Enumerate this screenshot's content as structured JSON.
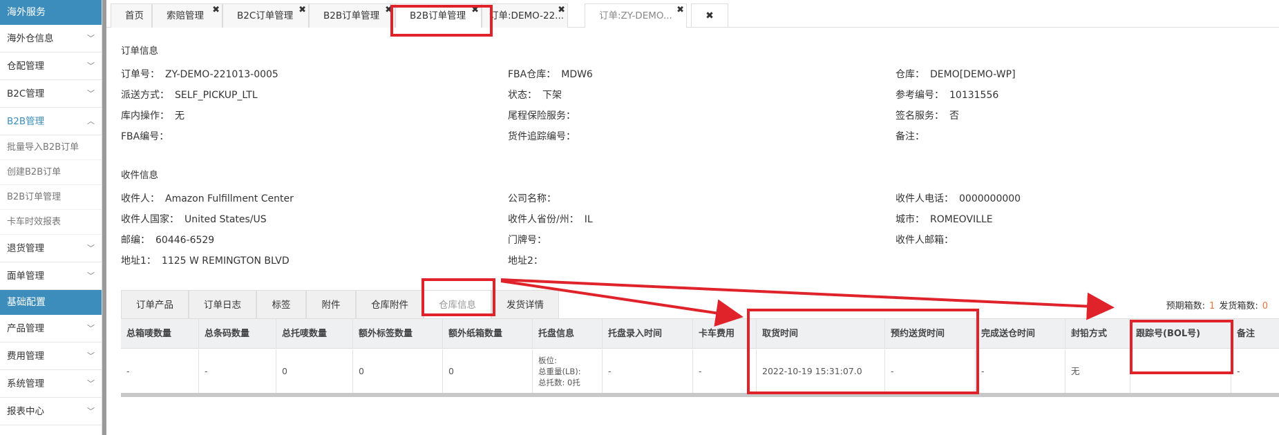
{
  "sidebar": {
    "header1": "海外服务",
    "items1": [
      {
        "label": "海外仓信息"
      },
      {
        "label": "仓配管理"
      },
      {
        "label": "B2C管理"
      },
      {
        "label": "B2B管理"
      }
    ],
    "b2b_sub": [
      {
        "label": "批量导入B2B订单"
      },
      {
        "label": "创建B2B订单"
      },
      {
        "label": "B2B订单管理"
      },
      {
        "label": "卡车时效报表"
      }
    ],
    "items2": [
      {
        "label": "退货管理"
      },
      {
        "label": "面单管理"
      }
    ],
    "header2": "基础配置",
    "items3": [
      {
        "label": "产品管理"
      },
      {
        "label": "费用管理"
      },
      {
        "label": "系统管理"
      },
      {
        "label": "报表中心"
      }
    ]
  },
  "tabs": [
    {
      "label": "首页"
    },
    {
      "label": "索赔管理"
    },
    {
      "label": "B2C订单管理"
    },
    {
      "label": "B2B订单管理"
    },
    {
      "label": "B2B订单管理"
    },
    {
      "label": "订单:DEMO-22..."
    },
    {
      "label": "订单:ZY-DEMO..."
    }
  ],
  "close_all": "✖",
  "order_info": {
    "title": "订单信息",
    "fields": [
      {
        "label": "订单号：",
        "value": "ZY-DEMO-221013-0005"
      },
      {
        "label": "FBA仓库：",
        "value": "MDW6"
      },
      {
        "label": "仓库：",
        "value": "DEMO[DEMO-WP]"
      },
      {
        "label": "派送方式：",
        "value": "SELF_PICKUP_LTL"
      },
      {
        "label": "状态：",
        "value": "下架"
      },
      {
        "label": "参考编号：",
        "value": "10131556"
      },
      {
        "label": "库内操作：",
        "value": "无"
      },
      {
        "label": "尾程保险服务：",
        "value": ""
      },
      {
        "label": "签名服务：",
        "value": "否"
      },
      {
        "label": "FBA编号：",
        "value": ""
      },
      {
        "label": "货件追踪编号：",
        "value": ""
      },
      {
        "label": "备注：",
        "value": ""
      }
    ]
  },
  "receiver_info": {
    "title": "收件信息",
    "fields": [
      {
        "label": "收件人：",
        "value": "Amazon Fulfillment Center"
      },
      {
        "label": "公司名称：",
        "value": ""
      },
      {
        "label": "收件人电话：",
        "value": "0000000000"
      },
      {
        "label": "收件人国家：",
        "value": "United States/US"
      },
      {
        "label": "收件人省份/州：",
        "value": "IL"
      },
      {
        "label": "城市：",
        "value": "ROMEOVILLE"
      },
      {
        "label": "邮编：",
        "value": "60446-6529"
      },
      {
        "label": "门牌号：",
        "value": ""
      },
      {
        "label": "收件人邮箱：",
        "value": ""
      },
      {
        "label": "地址1：",
        "value": "1125 W REMINGTON BLVD"
      },
      {
        "label": "地址2：",
        "value": ""
      }
    ]
  },
  "subtabs": [
    {
      "label": "订单产品"
    },
    {
      "label": "订单日志"
    },
    {
      "label": "标签"
    },
    {
      "label": "附件"
    },
    {
      "label": "仓库附件"
    },
    {
      "label": "仓库信息"
    },
    {
      "label": "发货详情"
    }
  ],
  "counts": {
    "expected_label": "预期箱数:",
    "expected": "1",
    "shipped_label": "发货箱数:",
    "shipped": "0"
  },
  "table": {
    "headers": [
      "总箱唛数量",
      "总条码数量",
      "总托唛数量",
      "额外标签数量",
      "额外纸箱数量",
      "托盘信息",
      "托盘录入时间",
      "卡车费用",
      "取货时间",
      "预约送货时间",
      "完成送仓时间",
      "封铅方式",
      "跟踪号(BOL号)",
      "备注"
    ],
    "row": [
      "-",
      "-",
      "0",
      "0",
      "0",
      "",
      "-",
      "-",
      "2022-10-19 15:31:07.0",
      "-",
      "-",
      "无",
      "",
      "-"
    ],
    "pallet": {
      "line1": "板位:",
      "line2": "总重量(LB):",
      "line3": "总托数: 0托"
    }
  },
  "colors": {
    "accent": "#3c8dbc",
    "annotation": "#e0222a",
    "count": "#e8743b"
  }
}
